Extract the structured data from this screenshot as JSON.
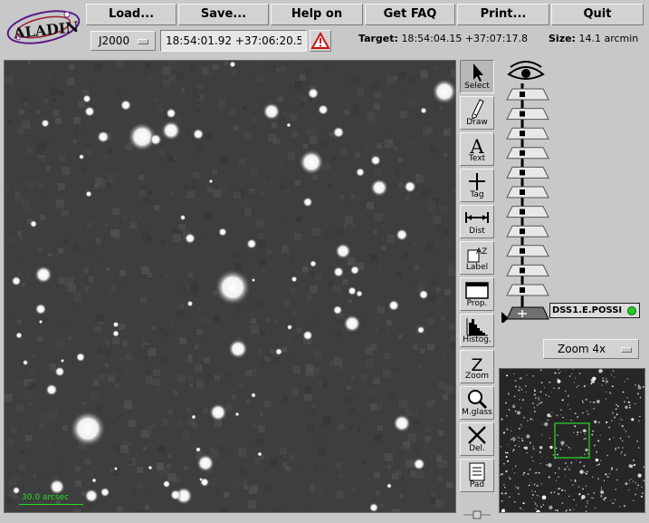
{
  "app": {
    "logo_text": "ALADIN"
  },
  "menu": [
    {
      "id": "load",
      "label": "Load..."
    },
    {
      "id": "save",
      "label": "Save..."
    },
    {
      "id": "help",
      "label": "Help on"
    },
    {
      "id": "faq",
      "label": "Get FAQ"
    },
    {
      "id": "print",
      "label": "Print..."
    },
    {
      "id": "quit",
      "label": "Quit"
    }
  ],
  "coords": {
    "frame": "J2000",
    "current_position": "18:54:01.92 +37:06:20.5",
    "target_label": "Target:",
    "target_value": "18:54:04.15 +37:07:17.8",
    "size_label": "Size:",
    "size_value": "14.1 arcmin"
  },
  "tools": [
    {
      "id": "select",
      "label": "Select",
      "icon": "arrow-cursor-icon",
      "active": true
    },
    {
      "id": "draw",
      "label": "Draw",
      "icon": "pencil-icon"
    },
    {
      "id": "text",
      "label": "Text",
      "icon": "letter-a-icon",
      "glyph": "A"
    },
    {
      "id": "tag",
      "label": "Tag",
      "icon": "crosshair-icon"
    },
    {
      "id": "dist",
      "label": "Dist",
      "icon": "distance-arrow-icon"
    },
    {
      "id": "label",
      "label": "Label",
      "icon": "label-az-icon",
      "glyph": "AZ"
    },
    {
      "id": "prop",
      "label": "Prop.",
      "icon": "window-icon"
    },
    {
      "id": "histog",
      "label": "Histog.",
      "icon": "histogram-icon"
    },
    {
      "id": "zoom",
      "label": "Zoom",
      "icon": "letter-z-icon",
      "glyph": "Z"
    },
    {
      "id": "mglass",
      "label": "M.glass",
      "icon": "magnifier-icon"
    },
    {
      "id": "del",
      "label": "Del.",
      "icon": "x-delete-icon"
    },
    {
      "id": "pad",
      "label": "Pad",
      "icon": "notepad-icon"
    }
  ],
  "stack": {
    "empty_planes": 11,
    "active_plane_label": "DSS1.E.POSSI",
    "status_color": "#22cc22"
  },
  "zoom": {
    "selected": "Zoom 4x"
  },
  "view": {
    "scale_label": "30.0 arcsec",
    "overlay_color": "#22dd22"
  }
}
